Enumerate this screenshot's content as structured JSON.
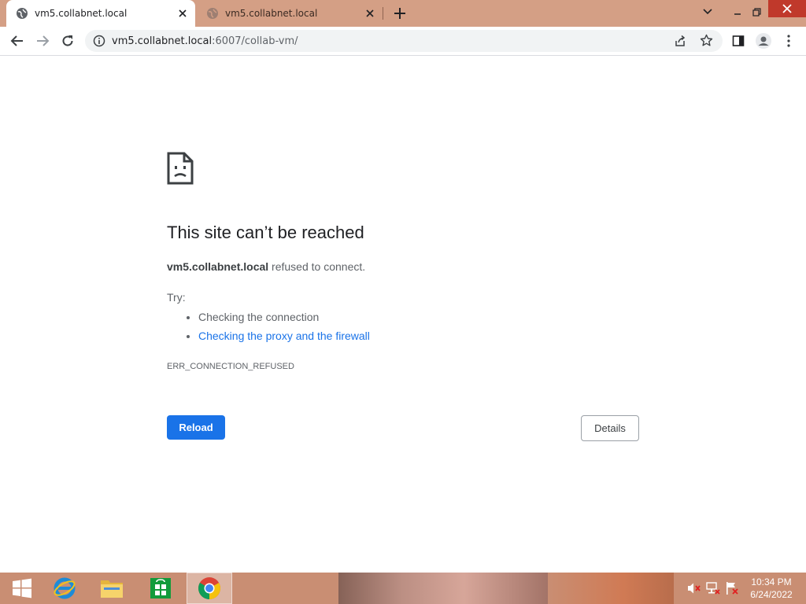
{
  "browser": {
    "tabs": [
      {
        "title": "vm5.collabnet.local",
        "active": true
      },
      {
        "title": "vm5.collabnet.local",
        "active": false
      }
    ],
    "address": {
      "host": "vm5.collabnet.local",
      "rest": ":6007/collab-vm/"
    }
  },
  "error_page": {
    "headline": "This site can’t be reached",
    "host": "vm5.collabnet.local",
    "message": " refused to connect.",
    "try_label": "Try:",
    "suggestions": [
      "Checking the connection",
      "Checking the proxy and the firewall"
    ],
    "error_code": "ERR_CONNECTION_REFUSED",
    "reload_label": "Reload",
    "details_label": "Details"
  },
  "taskbar": {
    "time": "10:34 PM",
    "date": "6/24/2022"
  },
  "colors": {
    "tabstrip": "#d49f85",
    "taskbar": "#c98e73",
    "accent_blue": "#1a73e8"
  },
  "icons": {
    "tab_favicon": "globe-icon",
    "error": "sad-page-icon",
    "start": "windows-start-icon"
  }
}
